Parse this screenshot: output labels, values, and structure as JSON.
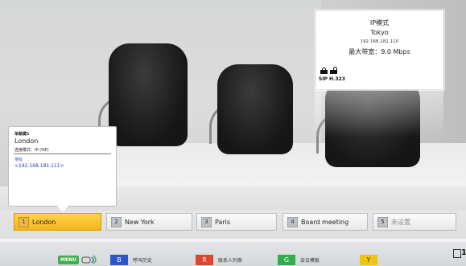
{
  "ip_info": {
    "mode": "IP模式",
    "city": "Tokyo",
    "address": "192.168.181.110",
    "bandwidth": "最大带宽：9.0 Mbps",
    "protocol": "SIP H.323"
  },
  "contact_popup": {
    "key": "单触键1",
    "name": "London",
    "connection_mode": "连接模式：IP (SIP)",
    "address_label": "地址",
    "address": "<192.168.181.111>"
  },
  "speed_dials": [
    {
      "num": "1",
      "label": "London",
      "state": "selected"
    },
    {
      "num": "2",
      "label": "New York",
      "state": "normal"
    },
    {
      "num": "3",
      "label": "Paris",
      "state": "normal"
    },
    {
      "num": "4",
      "label": "Board meeting",
      "state": "normal"
    },
    {
      "num": "5",
      "label": "未设置",
      "state": "unset"
    }
  ],
  "bottom_bar": {
    "menu_label": "MENU",
    "buttons": [
      {
        "key": "B",
        "label": "呼叫历史",
        "color": "#2c57c8"
      },
      {
        "key": "R",
        "label": "联系人列表",
        "color": "#e0452e"
      },
      {
        "key": "G",
        "label": "会议模板",
        "color": "#2fae4a"
      },
      {
        "key": "Y",
        "label": "",
        "color": "#f1c40f"
      }
    ],
    "corner_number": "1"
  },
  "colors": {
    "selected_dial": "#f4b61a",
    "link_text": "#1e3fb0"
  }
}
